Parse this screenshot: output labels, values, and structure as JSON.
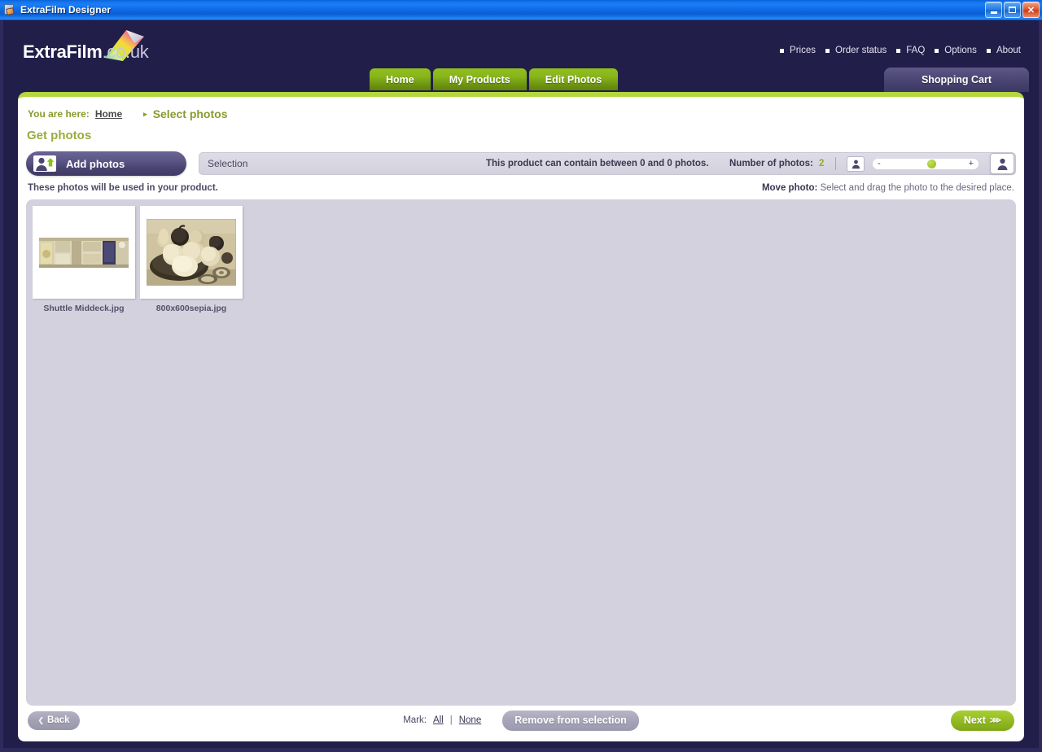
{
  "window": {
    "title": "ExtraFilm Designer",
    "icon": "app-icon",
    "minimize_label": "_",
    "maximize_label": "❐",
    "close_label": "✕"
  },
  "header": {
    "logo_name": "ExtraFilm",
    "logo_domain": ".co.uk",
    "topnav": [
      {
        "label": "Prices"
      },
      {
        "label": "Order status"
      },
      {
        "label": "FAQ"
      },
      {
        "label": "Options"
      },
      {
        "label": "About"
      }
    ],
    "tabs": [
      {
        "label": "Home"
      },
      {
        "label": "My Products"
      },
      {
        "label": "Edit Photos"
      }
    ],
    "cart_label": "Shopping Cart"
  },
  "breadcrumb": {
    "prefix": "You are here:",
    "home": "Home",
    "arrow": "▸",
    "current": "Select photos"
  },
  "page": {
    "title": "Get photos"
  },
  "toolbar": {
    "add_photos_label": "Add photos",
    "add_photos_icon": "person-upload-icon",
    "selection_label": "Selection",
    "product_info": "This product can contain between 0 and 0 photos.",
    "number_of_photos_label": "Number of photos:",
    "number_of_photos_value": "2",
    "zoom_small_icon": "person-small-icon",
    "zoom_big_icon": "person-large-icon",
    "slider_minus": "-",
    "slider_plus": "+",
    "slider_value_percent": 58
  },
  "hints": {
    "left": "These photos will be used in your product.",
    "move_photo_label": "Move photo:",
    "move_photo_text": "Select and drag the photo to the desired place."
  },
  "photos": [
    {
      "caption": "Shuttle Middeck.jpg",
      "kind": "panorama"
    },
    {
      "caption": "800x600sepia.jpg",
      "kind": "sepia-stilllife"
    }
  ],
  "footer": {
    "back_label": "Back",
    "back_chevron": "❮",
    "mark_label": "Mark:",
    "mark_all": "All",
    "mark_sep": "|",
    "mark_none": "None",
    "remove_label": "Remove from selection",
    "next_label": "Next",
    "next_chevron": "⋙"
  },
  "colors": {
    "title_bar_blue": "#1272ee",
    "header_navy": "#221e4a",
    "accent_green": "#93c01f",
    "panel_top_green": "#b5d63f",
    "photo_area_gray": "#d3d1dd",
    "purple_button": "#4c4774"
  }
}
